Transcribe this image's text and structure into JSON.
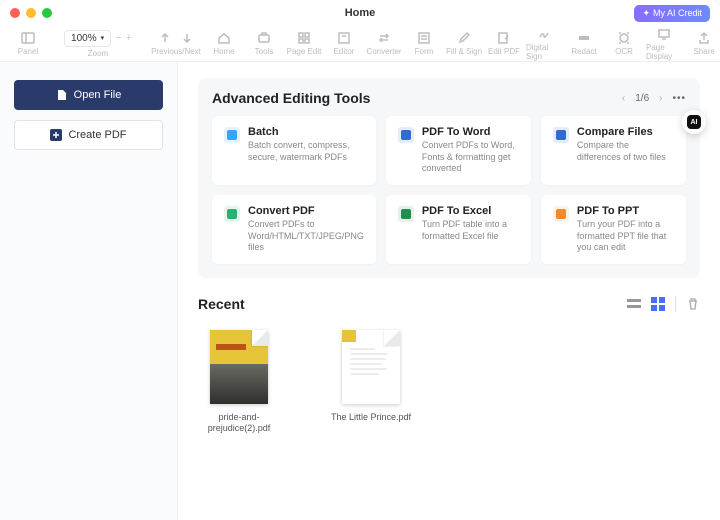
{
  "window": {
    "title": "Home"
  },
  "ai_credit": {
    "label": "My AI Credit",
    "spark": "✦"
  },
  "toolbar": {
    "panel": "Panel",
    "zoom_value": "100%",
    "zoom_label": "Zoom",
    "prev_next": "Previous/Next",
    "home": "Home",
    "tools": "Tools",
    "page_edit": "Page Edit",
    "editor": "Editor",
    "converter": "Converter",
    "form": "Form",
    "fill_sign": "Fill & Sign",
    "edit_pdf": "Edit PDF",
    "digital_sign": "Digital Sign",
    "redact": "Redact",
    "ocr": "OCR",
    "page_display": "Page Display",
    "share": "Share"
  },
  "sidebar": {
    "open_label": "Open File",
    "create_label": "Create PDF"
  },
  "advanced": {
    "title": "Advanced Editing Tools",
    "page_indicator": "1/6",
    "cards": [
      {
        "name": "Batch",
        "desc": "Batch convert, compress, secure, watermark PDFs",
        "color": "#3aa3ff"
      },
      {
        "name": "PDF To Word",
        "desc": "Convert PDFs to Word, Fonts & formatting get converted",
        "color": "#2f6bd0"
      },
      {
        "name": "Compare Files",
        "desc": "Compare the differences of two files",
        "color": "#2f6bd0"
      },
      {
        "name": "Convert PDF",
        "desc": "Convert PDFs to Word/HTML/TXT/JPEG/PNG files",
        "color": "#27b36f"
      },
      {
        "name": "PDF To Excel",
        "desc": "Turn PDF table into a formatted Excel file",
        "color": "#1e8f4e"
      },
      {
        "name": "PDF To PPT",
        "desc": "Turn your PDF into a formatted PPT file that you can edit",
        "color": "#f08a2a"
      }
    ]
  },
  "recent": {
    "title": "Recent",
    "docs": [
      {
        "name": "pride-and-prejudice(2).pdf"
      },
      {
        "name": "The Little Prince.pdf"
      }
    ]
  }
}
